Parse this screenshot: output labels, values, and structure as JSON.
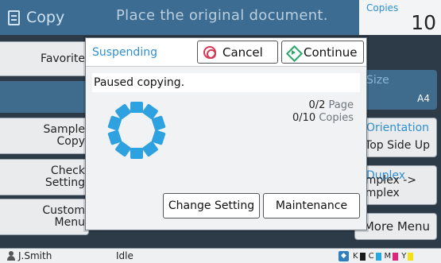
{
  "header": {
    "app_title": "Copy",
    "message": "Place the original document.",
    "copies_label": "Copies",
    "copies_value": "10"
  },
  "left_menu": [
    {
      "label": "Favorite",
      "icon": "star-folder-icon"
    },
    {
      "label": "",
      "icon": ""
    },
    {
      "label": "Sample\nCopy",
      "icon": "checkbox-icon"
    },
    {
      "label": "Check\nSetting",
      "icon": "magnifier-check-icon"
    },
    {
      "label": "Custom\nMenu",
      "icon": "wrench-icon"
    }
  ],
  "right_menu": {
    "size_header": "Size",
    "size_value": "A4",
    "orientation_header": "Orientation",
    "orientation_value": "Top Side Up",
    "duplex_header": "Duplex",
    "duplex_value": "Simplex -> Simplex",
    "more_label": "More Menu"
  },
  "dialog": {
    "title": "Suspending",
    "cancel_label": "Cancel",
    "continue_label": "Continue",
    "message": "Paused copying.",
    "page_progress": "0/2",
    "page_unit": "Page",
    "copies_progress": "0/10",
    "copies_unit": "Copies",
    "change_setting_label": "Change Setting",
    "maintenance_label": "Maintenance"
  },
  "status_bar": {
    "user": "J.Smith",
    "status": "Idle",
    "ink": [
      {
        "label": "K",
        "color": "#1a1a1a"
      },
      {
        "label": "C",
        "color": "#26a9e0"
      },
      {
        "label": "M",
        "color": "#e0247c"
      },
      {
        "label": "Y",
        "color": "#f3e018"
      }
    ]
  },
  "colors": {
    "accent": "#2f8fd0",
    "topbar": "#3c6c91",
    "spinner": "#2ea2e0",
    "cancel": "#d43a54",
    "continue": "#2aa86a"
  }
}
